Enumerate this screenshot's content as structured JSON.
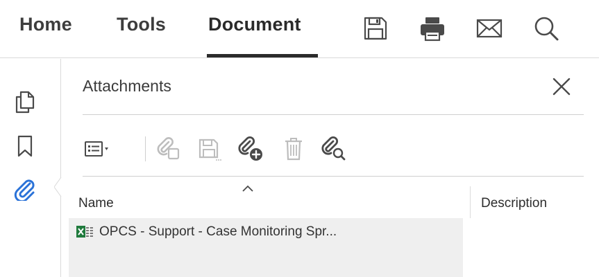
{
  "menu": {
    "tabs": [
      {
        "label": "Home"
      },
      {
        "label": "Tools"
      },
      {
        "label": "Document"
      }
    ],
    "active_tab": "Document",
    "toolbar_icons": [
      "save-icon",
      "print-icon",
      "email-icon",
      "search-icon"
    ]
  },
  "rail": {
    "icons": [
      "pages-icon",
      "bookmark-icon",
      "attachment-icon"
    ]
  },
  "panel": {
    "title": "Attachments",
    "toolbar_icons": [
      "options-menu-icon",
      "open-attachment-icon",
      "save-attachment-icon",
      "add-attachment-icon",
      "delete-attachment-icon",
      "search-attachment-icon"
    ]
  },
  "table": {
    "columns": [
      {
        "label": "Name"
      },
      {
        "label": "Description"
      }
    ],
    "rows": [
      {
        "name": "OPCS - Support - Case Monitoring Spr...",
        "description": "",
        "icon": "excel-file-icon"
      }
    ]
  },
  "colors": {
    "accent_blue": "#2a72d8",
    "excel_green": "#1f7a3c",
    "icon_dark": "#4a4a4a",
    "icon_disabled": "#bdbdbd",
    "row_selected": "#efefef"
  }
}
